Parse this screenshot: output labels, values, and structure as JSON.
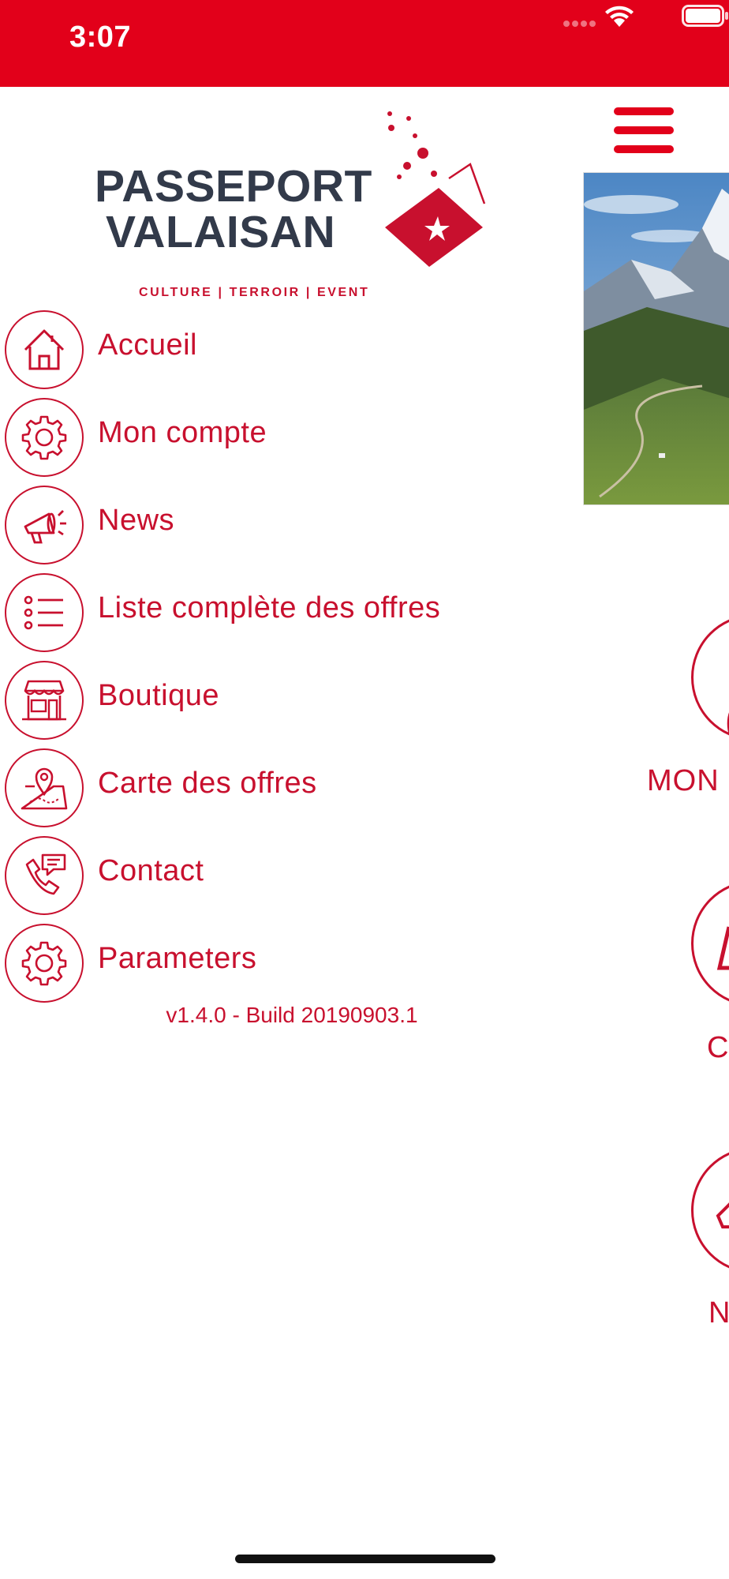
{
  "status_bar": {
    "time": "3:07"
  },
  "colors": {
    "brand_red": "#e2001a",
    "accent_red": "#c8102e",
    "logo_text": "#323a4a"
  },
  "logo": {
    "title_line1": "PASSEPORT",
    "title_line2": "VALAISAN",
    "tagline": "CULTURE | TERROIR | EVENT"
  },
  "menu": {
    "items": [
      {
        "label": "Accueil",
        "icon": "home-icon"
      },
      {
        "label": "Mon compte",
        "icon": "gear-icon"
      },
      {
        "label": "News",
        "icon": "megaphone-icon"
      },
      {
        "label": "Liste complète des offres",
        "icon": "list-icon"
      },
      {
        "label": "Boutique",
        "icon": "shop-icon"
      },
      {
        "label": "Carte des offres",
        "icon": "map-pin-icon"
      },
      {
        "label": "Contact",
        "icon": "phone-chat-icon"
      },
      {
        "label": "Parameters",
        "icon": "gear-icon"
      }
    ]
  },
  "version": "v1.4.0 - Build 20190903.1",
  "background_screen": {
    "tile_labels": [
      "MON",
      "C",
      "N"
    ]
  }
}
